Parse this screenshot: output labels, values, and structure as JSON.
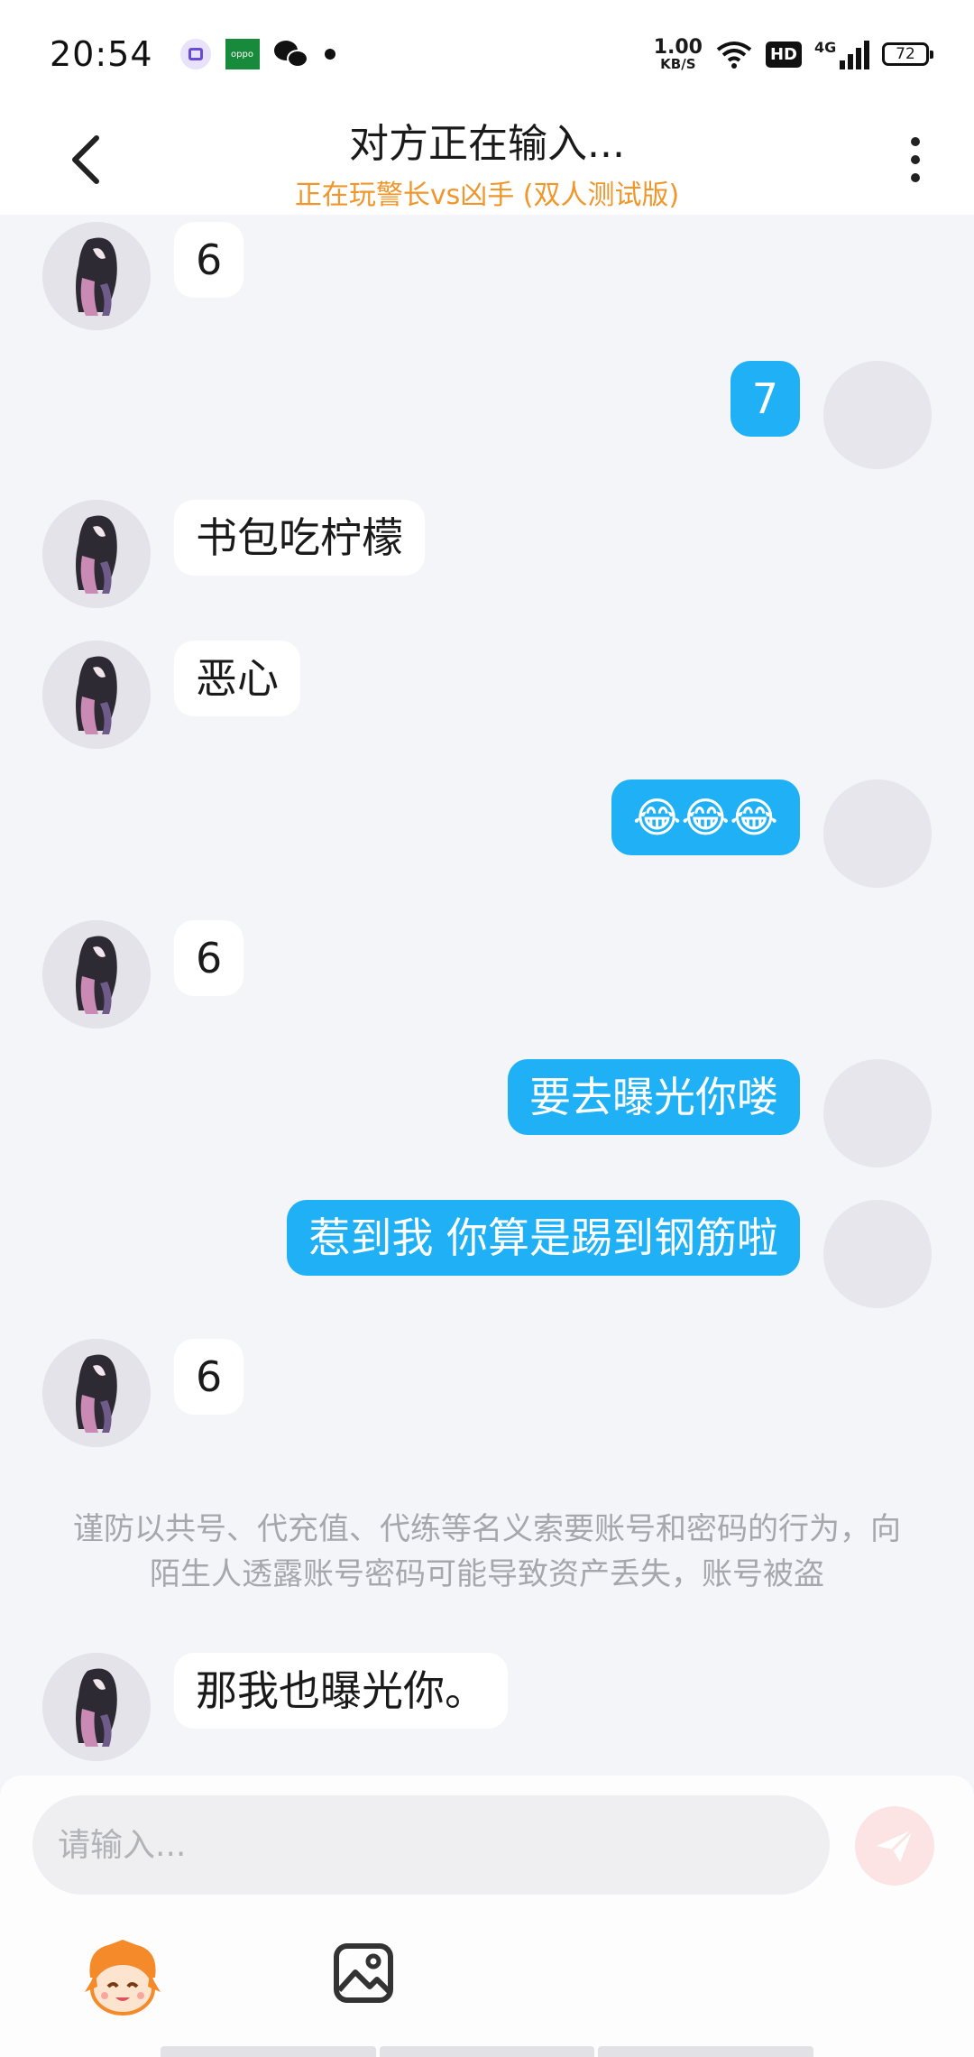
{
  "status_bar": {
    "time": "20:54",
    "net_speed_value": "1.00",
    "net_speed_unit": "KB/S",
    "hd_label": "HD",
    "network_label": "4G",
    "battery": "72",
    "oppo_label": "oppo"
  },
  "header": {
    "title": "对方正在输入...",
    "subtitle": "正在玩警长vs凶手 (双人测试版)"
  },
  "messages": [
    {
      "side": "peer",
      "text": "6"
    },
    {
      "side": "self",
      "text": "7"
    },
    {
      "side": "peer",
      "text": "书包吃柠檬"
    },
    {
      "side": "peer",
      "text": "恶心"
    },
    {
      "side": "self",
      "text": "😂😂😂"
    },
    {
      "side": "peer",
      "text": "6"
    },
    {
      "side": "self",
      "text": "要去曝光你喽"
    },
    {
      "side": "self",
      "text": "惹到我 你算是踢到钢筋啦"
    },
    {
      "side": "peer",
      "text": "6"
    },
    {
      "side": "peer",
      "text": "那我也曝光你。"
    }
  ],
  "notice": "谨防以共号、代充值、代练等名义索要账号和密码的行为，向陌生人透露账号密码可能导致资产丢失，账号被盗",
  "input": {
    "placeholder": "请输入..."
  },
  "colors": {
    "self_bubble": "#1fb0f5",
    "subtitle": "#f0962a",
    "send_button": "#fde4e4"
  }
}
